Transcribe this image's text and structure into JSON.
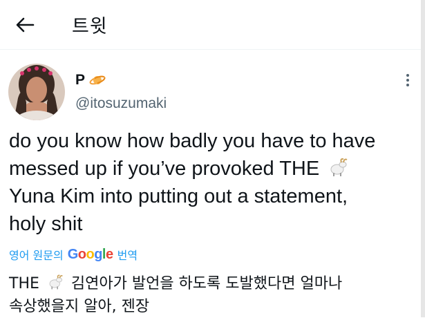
{
  "header": {
    "back_icon": "arrow-left-icon",
    "title": "트윗"
  },
  "tweet": {
    "author": {
      "display_name": "P",
      "badge_icon": "planet-emoji-icon",
      "handle": "@itosuzumaki"
    },
    "more_icon": "more-vertical-icon",
    "text_line1": "do you know how badly you have to have",
    "text_line2": "messed up if you’ve provoked THE",
    "text_line3": "Yuna Kim into putting out a statement,",
    "text_line4": "holy shit",
    "goat_icon": "goat-emoji-icon",
    "translate": {
      "prefix": "영어 원문의",
      "brand": "Google",
      "suffix": "번역"
    },
    "translation_line1_a": "THE",
    "translation_line1_b": "김연아가 발언을 하도록 도발했다면 얼마나",
    "translation_line2": "속상했을지 알아, 젠장"
  },
  "colors": {
    "link": "#1d9bf0",
    "secondary_text": "#536471",
    "divider": "#eff3f4"
  }
}
